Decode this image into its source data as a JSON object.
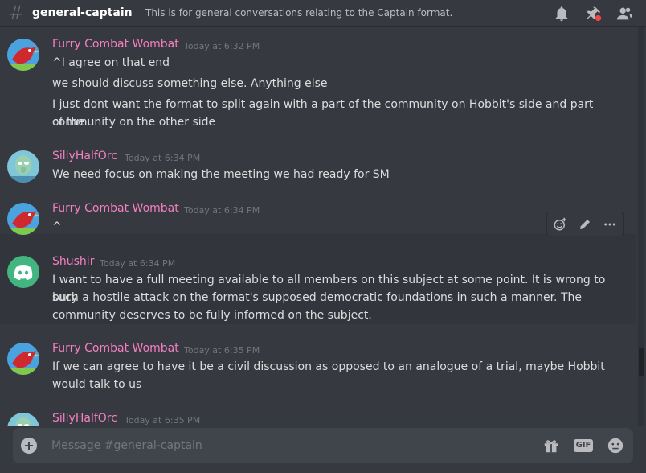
{
  "header": {
    "hash": "#",
    "channel": "general-captain",
    "topic": "This is for general conversations relating to the Captain format.",
    "icons": [
      "bell-icon",
      "pin-icon",
      "members-icon"
    ]
  },
  "messages": [
    {
      "author": "Furry Combat Wombat",
      "timestamp": "Today at 6:32 PM",
      "avatar": "red-bird-avatar",
      "lines": [
        "^I agree on that end",
        "we should discuss something else. Anything else",
        "I just dont want the format to split again with a part of the community on Hobbit's side and part of the",
        "community on the other side"
      ]
    },
    {
      "author": "SillyHalfOrc",
      "timestamp": "Today at 6:34 PM",
      "avatar": "squidward-avatar",
      "lines": [
        "We need focus on making the meeting we had ready for SM"
      ]
    },
    {
      "author": "Furry Combat Wombat",
      "timestamp": "Today at 6:34 PM",
      "avatar": "red-bird-avatar",
      "lines": [
        "^"
      ]
    },
    {
      "author": "Shushir",
      "timestamp": "Today at 6:34 PM",
      "avatar": "discord-default-avatar",
      "lines": [
        "I want to have a full meeting available to all members on this subject at some point. It is wrong to bury",
        "such a hostile attack on the format's supposed democratic foundations in such a manner. The",
        "community deserves to be fully informed on the subject."
      ]
    },
    {
      "author": "Furry Combat Wombat",
      "timestamp": "Today at 6:35 PM",
      "avatar": "red-bird-avatar",
      "lines": [
        "If we can agree to have it be a civil discussion as opposed to an analogue of a trial, maybe Hobbit",
        "would talk to us"
      ]
    },
    {
      "author": "SillyHalfOrc",
      "timestamp": "Today at 6:35 PM",
      "avatar": "squidward-avatar",
      "lines": []
    }
  ],
  "toolbar": {
    "icons": [
      "add-reaction-icon",
      "edit-icon",
      "more-icon"
    ]
  },
  "composer": {
    "placeholder": "Message #general-captain",
    "value": "",
    "gif_label": "GIF",
    "icons": [
      "plus-icon",
      "gift-icon",
      "gif-icon",
      "emoji-icon"
    ]
  },
  "colors": {
    "background": "#36393f",
    "username": "#f47fc2",
    "timestamp": "#72767d",
    "text": "#dcddde",
    "shushir_avatar": "#43b581"
  }
}
